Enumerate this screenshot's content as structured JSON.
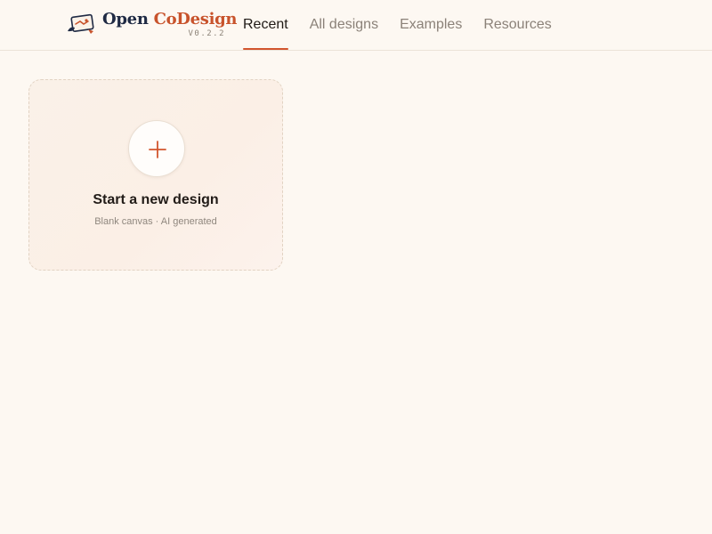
{
  "brand": {
    "name_part1": "Open",
    "name_part2": "CoDesign",
    "version": "V0.2.2",
    "logo_icon": "open-codesign-logo-icon"
  },
  "nav": {
    "tabs": [
      {
        "label": "Recent",
        "active": true
      },
      {
        "label": "All designs",
        "active": false
      },
      {
        "label": "Examples",
        "active": false
      },
      {
        "label": "Resources",
        "active": false
      }
    ]
  },
  "new_design_card": {
    "title": "Start a new design",
    "subtitle": "Blank canvas · AI generated",
    "icon": "plus-icon"
  },
  "colors": {
    "accent": "#d2552e",
    "brand_navy": "#1f2a44",
    "background": "#fdf8f2"
  }
}
